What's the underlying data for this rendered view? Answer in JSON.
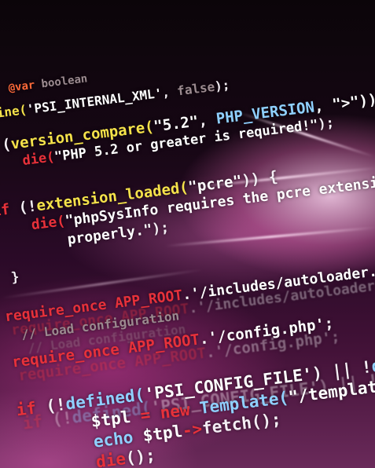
{
  "code_lines": [
    {
      "parts": [
        {
          "t": "@var",
          "c": "ann"
        },
        {
          "t": " boolean",
          "c": "cm"
        }
      ]
    },
    {
      "parts": [
        {
          "t": "efine(",
          "c": "fn"
        },
        {
          "t": "'PSI_INTERNAL_XML'",
          "c": "str"
        },
        {
          "t": ", ",
          "c": "plain"
        },
        {
          "t": "false",
          "c": "cm"
        },
        {
          "t": ");",
          "c": "plain"
        }
      ]
    },
    {
      "parts": [
        {
          "t": "f ",
          "c": "kw"
        },
        {
          "t": "(",
          "c": "plain"
        },
        {
          "t": "version_compare(",
          "c": "fn"
        },
        {
          "t": "\"5.2\"",
          "c": "str"
        },
        {
          "t": ", ",
          "c": "plain"
        },
        {
          "t": "PHP_VERSION",
          "c": "cst"
        },
        {
          "t": ", \">\")) {",
          "c": "str"
        }
      ]
    },
    {
      "parts": [
        {
          "t": "  die(",
          "c": "kw"
        },
        {
          "t": "\"PHP 5.2 or greater is required!\"",
          "c": "str"
        },
        {
          "t": ");",
          "c": "plain"
        }
      ]
    },
    {
      "parts": [
        {
          "t": "}",
          "c": "plain"
        }
      ]
    },
    {
      "parts": [
        {
          "t": "if ",
          "c": "kw"
        },
        {
          "t": "(!",
          "c": "plain"
        },
        {
          "t": "extension_loaded(",
          "c": "fn"
        },
        {
          "t": "\"pcre\"",
          "c": "str"
        },
        {
          "t": ")) {",
          "c": "plain"
        }
      ]
    },
    {
      "parts": [
        {
          "t": "  die(",
          "c": "kw"
        },
        {
          "t": "\"phpSysInfo requires the pcre extension",
          "c": "str"
        }
      ]
    },
    {
      "parts": [
        {
          "t": "      properly.\"",
          "c": "str"
        },
        {
          "t": ");",
          "c": "plain"
        }
      ]
    },
    {
      "parts": [
        {
          "t": "}",
          "c": "plain"
        }
      ]
    },
    {
      "parts": [
        {
          "t": "require_once ",
          "c": "kw"
        },
        {
          "t": "APP_ROOT",
          "c": "kw"
        },
        {
          "t": ".'/includes/autoloader.i",
          "c": "str"
        }
      ]
    },
    {
      "parts": [
        {
          "t": "// Load configuration",
          "c": "cm"
        }
      ]
    },
    {
      "parts": [
        {
          "t": "require_once ",
          "c": "kw"
        },
        {
          "t": "APP_ROOT",
          "c": "kw"
        },
        {
          "t": ".'/config.php'",
          "c": "str"
        },
        {
          "t": ";",
          "c": "plain"
        }
      ]
    },
    {
      "parts": [
        {
          "t": "if ",
          "c": "kw"
        },
        {
          "t": "(!",
          "c": "plain"
        },
        {
          "t": "defined(",
          "c": "cst"
        },
        {
          "t": "'PSI_CONFIG_FILE'",
          "c": "str"
        },
        {
          "t": ") || !",
          "c": "plain"
        },
        {
          "t": "defined",
          "c": "cst"
        }
      ]
    },
    {
      "parts": [
        {
          "t": "    $tpl ",
          "c": "id"
        },
        {
          "t": "= new ",
          "c": "kw"
        },
        {
          "t": "Template(",
          "c": "cst"
        },
        {
          "t": "\"/templates/html/e",
          "c": "str"
        }
      ]
    },
    {
      "parts": [
        {
          "t": "    echo ",
          "c": "cst"
        },
        {
          "t": "$tpl",
          "c": "id"
        },
        {
          "t": "->",
          "c": "kw"
        },
        {
          "t": "fetch();",
          "c": "plain"
        }
      ]
    },
    {
      "parts": [
        {
          "t": "    die",
          "c": "kw"
        },
        {
          "t": "();",
          "c": "plain"
        }
      ]
    }
  ]
}
